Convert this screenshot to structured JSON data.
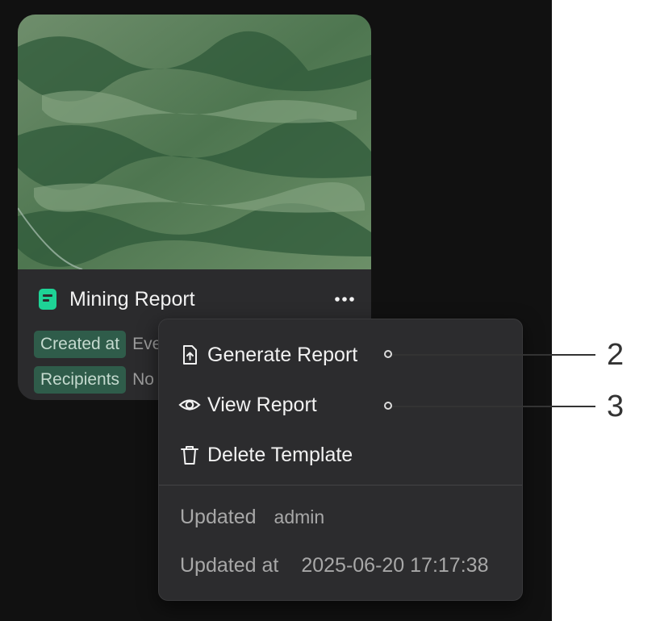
{
  "card": {
    "title": "Mining Report",
    "meta": [
      {
        "label": "Created at",
        "value": "Every"
      },
      {
        "label": "Recipients",
        "value": "No"
      }
    ]
  },
  "menu": {
    "items": [
      {
        "label": "Generate Report",
        "icon": "file-upload-icon"
      },
      {
        "label": "View Report",
        "icon": "eye-icon"
      },
      {
        "label": "Delete Template",
        "icon": "trash-icon"
      }
    ],
    "updated_label": "Updated",
    "updated_value": "admin",
    "updated_at_label": "Updated at",
    "updated_at_value": "2025-06-20 17:17:38"
  },
  "callouts": [
    {
      "number": "2",
      "target": "generate-report"
    },
    {
      "number": "3",
      "target": "view-report"
    }
  ],
  "colors": {
    "accent": "#1ed396",
    "badge_bg": "#2f5c4a",
    "menu_bg": "#2c2c2e",
    "card_bg": "#2b2b2d"
  }
}
